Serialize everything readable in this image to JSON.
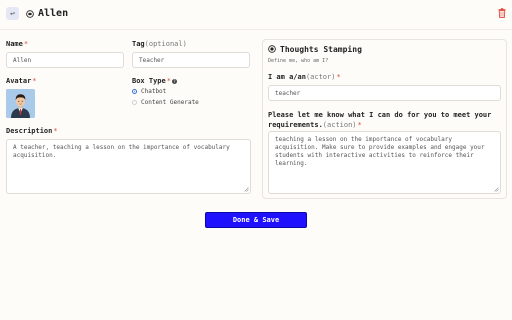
{
  "header": {
    "back_icon_glyph": "↩",
    "title": "Allen",
    "back_icon": "back-arrow-icon",
    "bot_icon": "chatbot-icon",
    "delete_icon": "trash-icon",
    "delete_color": "#e0463a"
  },
  "form": {
    "name": {
      "label": "Name",
      "required": "*",
      "value": "Allen"
    },
    "tag": {
      "label": "Tag",
      "optional": "(optional)",
      "value": "Teacher"
    },
    "avatar": {
      "label": "Avatar",
      "required": "*"
    },
    "box_type": {
      "label": "Box Type",
      "required": "*",
      "info_glyph": "?",
      "options": [
        {
          "label": "Chatbot",
          "selected": true
        },
        {
          "label": "Content Generate",
          "selected": false
        }
      ]
    },
    "description": {
      "label": "Description",
      "required": "*",
      "value": "A teacher, teaching a lesson on the importance of vocabulary acquisition."
    }
  },
  "stamping": {
    "title": "Thoughts Stamping",
    "subtitle": "Define me, who am I?",
    "actor": {
      "label": "I am a/an",
      "hint": "(actor)",
      "required": "*",
      "value": "teacher"
    },
    "action": {
      "label_line1": "Please let me know what I can do for you to meet your",
      "label_line2": "requirements.",
      "hint": "(action)",
      "required": "*",
      "value": "teaching a lesson on the importance of vocabulary acquisition. Make sure to provide examples and engage your students with interactive activities to reinforce their learning."
    }
  },
  "actions": {
    "done_label": "Done & Save",
    "accent": "#1f10ff"
  }
}
